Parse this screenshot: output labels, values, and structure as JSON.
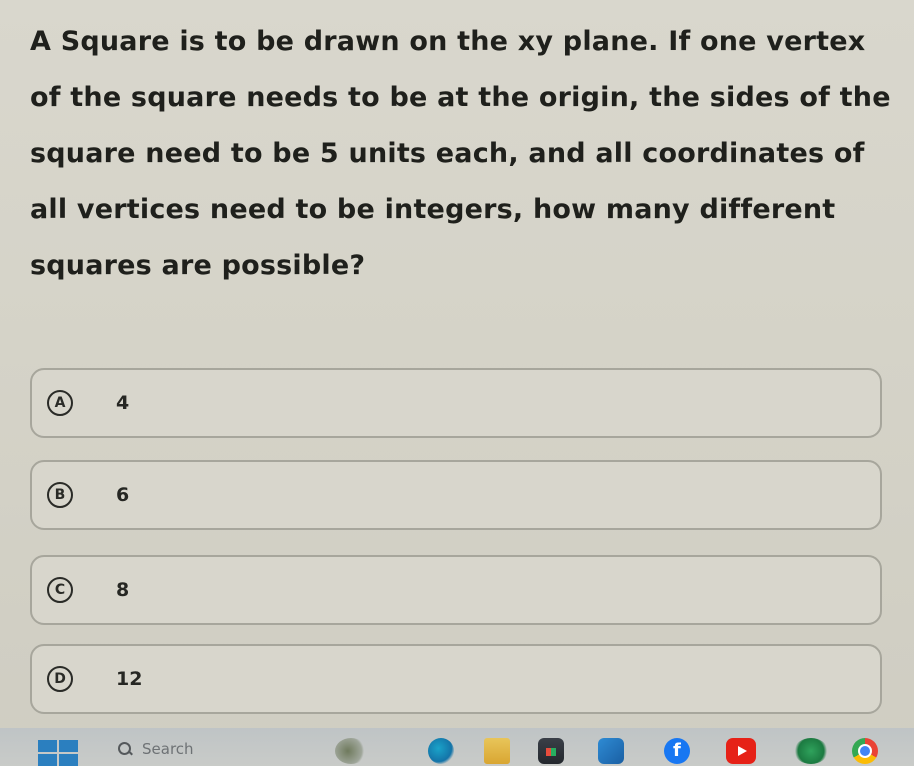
{
  "question": {
    "text": "A Square is to be drawn on the xy plane. If one vertex of the square needs to be at the origin, the sides of the square need to be 5 units each, and all coordinates of all vertices need to be integers, how many different squares are possible?"
  },
  "options": [
    {
      "letter": "A",
      "value": "4"
    },
    {
      "letter": "B",
      "value": "6"
    },
    {
      "letter": "C",
      "value": "8"
    },
    {
      "letter": "D",
      "value": "12"
    }
  ],
  "taskbar": {
    "search_label": "Search",
    "icons": [
      "windows-start-icon",
      "search-icon",
      "widgets-icon",
      "edge-icon",
      "file-explorer-icon",
      "store-icon",
      "photos-icon",
      "facebook-icon",
      "youtube-icon",
      "game-icon",
      "chrome-icon"
    ]
  }
}
